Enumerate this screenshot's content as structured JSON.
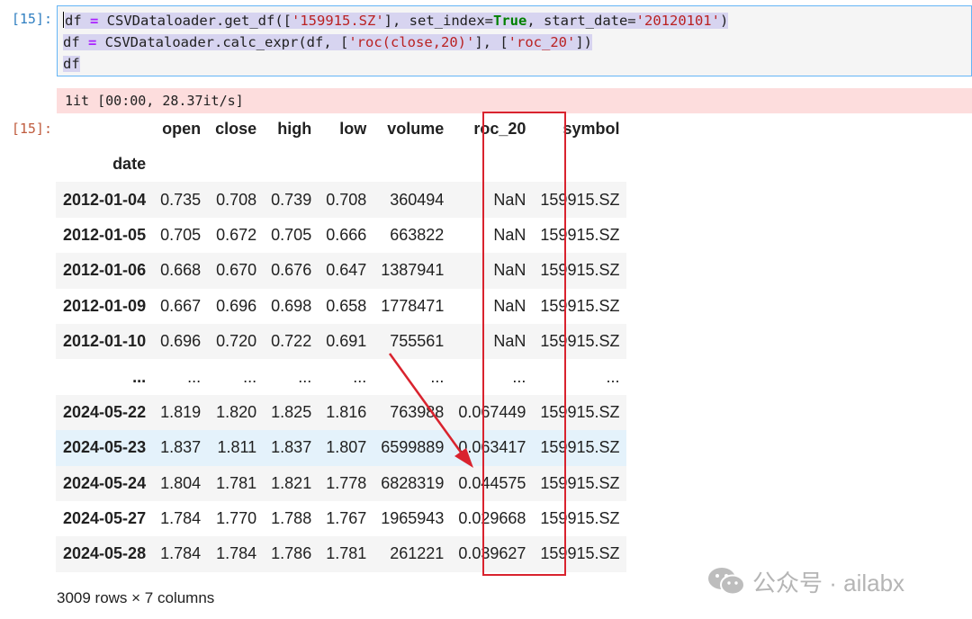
{
  "input_cell": {
    "prompt": "[15]:",
    "lines": [
      [
        "df",
        " = ",
        "CSVDataloader",
        ".",
        "get_df",
        "([",
        "'159915.SZ'",
        "], set_index=",
        "True",
        ", start_date=",
        "'20120101'",
        ")"
      ],
      [
        "df",
        " = ",
        "CSVDataloader",
        ".",
        "calc_expr",
        "(df, [",
        "'roc(close,20)'",
        "], [",
        "'roc_20'",
        "])"
      ],
      [
        "df"
      ]
    ]
  },
  "stderr": {
    "text": "1it [00:00, 28.37it/s]"
  },
  "output_cell": {
    "prompt": "[15]:",
    "index_name": "date",
    "columns": [
      "open",
      "close",
      "high",
      "low",
      "volume",
      "roc_20",
      "symbol"
    ],
    "rows": [
      [
        "2012-01-04",
        "0.735",
        "0.708",
        "0.739",
        "0.708",
        "360494",
        "NaN",
        "159915.SZ"
      ],
      [
        "2012-01-05",
        "0.705",
        "0.672",
        "0.705",
        "0.666",
        "663822",
        "NaN",
        "159915.SZ"
      ],
      [
        "2012-01-06",
        "0.668",
        "0.670",
        "0.676",
        "0.647",
        "1387941",
        "NaN",
        "159915.SZ"
      ],
      [
        "2012-01-09",
        "0.667",
        "0.696",
        "0.698",
        "0.658",
        "1778471",
        "NaN",
        "159915.SZ"
      ],
      [
        "2012-01-10",
        "0.696",
        "0.720",
        "0.722",
        "0.691",
        "755561",
        "NaN",
        "159915.SZ"
      ],
      [
        "...",
        "...",
        "...",
        "...",
        "...",
        "...",
        "...",
        "..."
      ],
      [
        "2024-05-22",
        "1.819",
        "1.820",
        "1.825",
        "1.816",
        "763988",
        "0.067449",
        "159915.SZ"
      ],
      [
        "2024-05-23",
        "1.837",
        "1.811",
        "1.837",
        "1.807",
        "6599889",
        "0.063417",
        "159915.SZ"
      ],
      [
        "2024-05-24",
        "1.804",
        "1.781",
        "1.821",
        "1.778",
        "6828319",
        "0.044575",
        "159915.SZ"
      ],
      [
        "2024-05-27",
        "1.784",
        "1.770",
        "1.788",
        "1.767",
        "1965943",
        "0.029668",
        "159915.SZ"
      ],
      [
        "2024-05-28",
        "1.784",
        "1.784",
        "1.786",
        "1.781",
        "261221",
        "0.039627",
        "159915.SZ"
      ]
    ],
    "hovered_row_index": 7,
    "shape_text": "3009 rows × 7 columns"
  },
  "annotation": {
    "color": "#d9232e",
    "highlighted_column": "roc_20"
  },
  "watermark": {
    "text": "公众号 · ailabx",
    "icon": "wechat-icon"
  },
  "colors": {
    "input_prompt": "#307fc1",
    "output_prompt": "#bf5b3d",
    "selection": "#d7d4f0",
    "stderr_bg": "#fddddd",
    "row_hover": "#e4f2fb"
  }
}
